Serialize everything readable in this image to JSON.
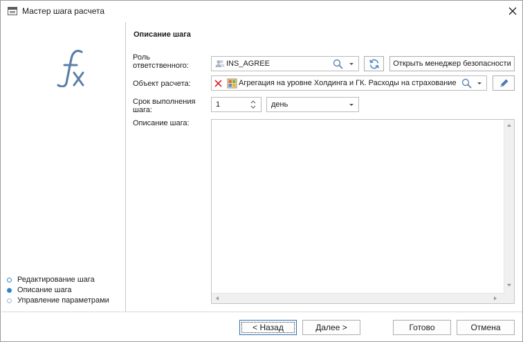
{
  "window": {
    "title": "Мастер шага расчета"
  },
  "sidebar": {
    "steps": [
      {
        "label": "Редактирование шага",
        "active": false
      },
      {
        "label": "Описание шага",
        "active": true
      },
      {
        "label": "Управление параметрами",
        "active": false
      }
    ]
  },
  "main": {
    "section_title": "Описание шага",
    "role": {
      "label_line1": "Роль",
      "label_line2": "ответственного:",
      "value": "INS_AGREE",
      "manager_button": "Открыть менеджер безопасности"
    },
    "object": {
      "label": "Объект расчета:",
      "value": "Агрегация на уровне Холдинга и ГК. Расходы на страхование"
    },
    "deadline": {
      "label_line1": "Срок выполнения",
      "label_line2": "шага:",
      "number": "1",
      "unit": "день"
    },
    "description": {
      "label": "Описание шага:",
      "text": ""
    }
  },
  "footer": {
    "back": "< Назад",
    "next": "Далее >",
    "done": "Готово",
    "cancel": "Отмена"
  },
  "colors": {
    "accent": "#2e86d1",
    "fx_logo": "#5b7fa8",
    "clear_red": "#d9262b"
  },
  "icons": [
    "window-icon",
    "close-icon",
    "fx-icon",
    "users-icon",
    "search-icon",
    "refresh-icon",
    "clear-icon",
    "cube-icon",
    "pencil-icon",
    "spin-up-icon",
    "spin-down-icon",
    "chevron-down-icon"
  ]
}
